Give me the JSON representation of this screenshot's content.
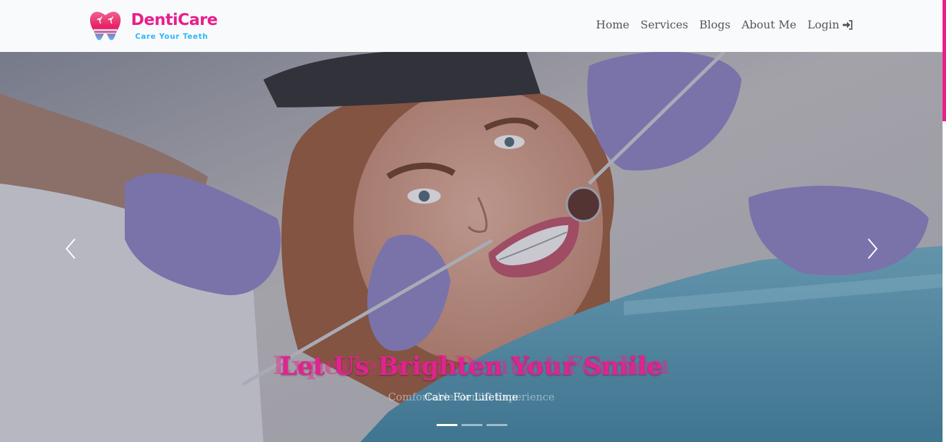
{
  "brand": {
    "name": "DentiCare",
    "tagline": "Care Your Teeth",
    "colors": {
      "primary": "#e91e8c",
      "secondary": "#29b6f6"
    }
  },
  "nav": {
    "items": [
      {
        "label": "Home"
      },
      {
        "label": "Services"
      },
      {
        "label": "Blogs"
      },
      {
        "label": "About Me"
      },
      {
        "label": "Login",
        "icon": "login-icon"
      }
    ]
  },
  "hero": {
    "title": "Let Us Brighten Your Smile",
    "title_ghost": "Experienced Dentist For You",
    "subtitle": "Care For Lifetime",
    "subtitle_ghost": "Comfortable Dental Experience",
    "prev_icon": "chevron-left-icon",
    "next_icon": "chevron-right-icon",
    "slides_count": 3,
    "active_slide": 1
  }
}
